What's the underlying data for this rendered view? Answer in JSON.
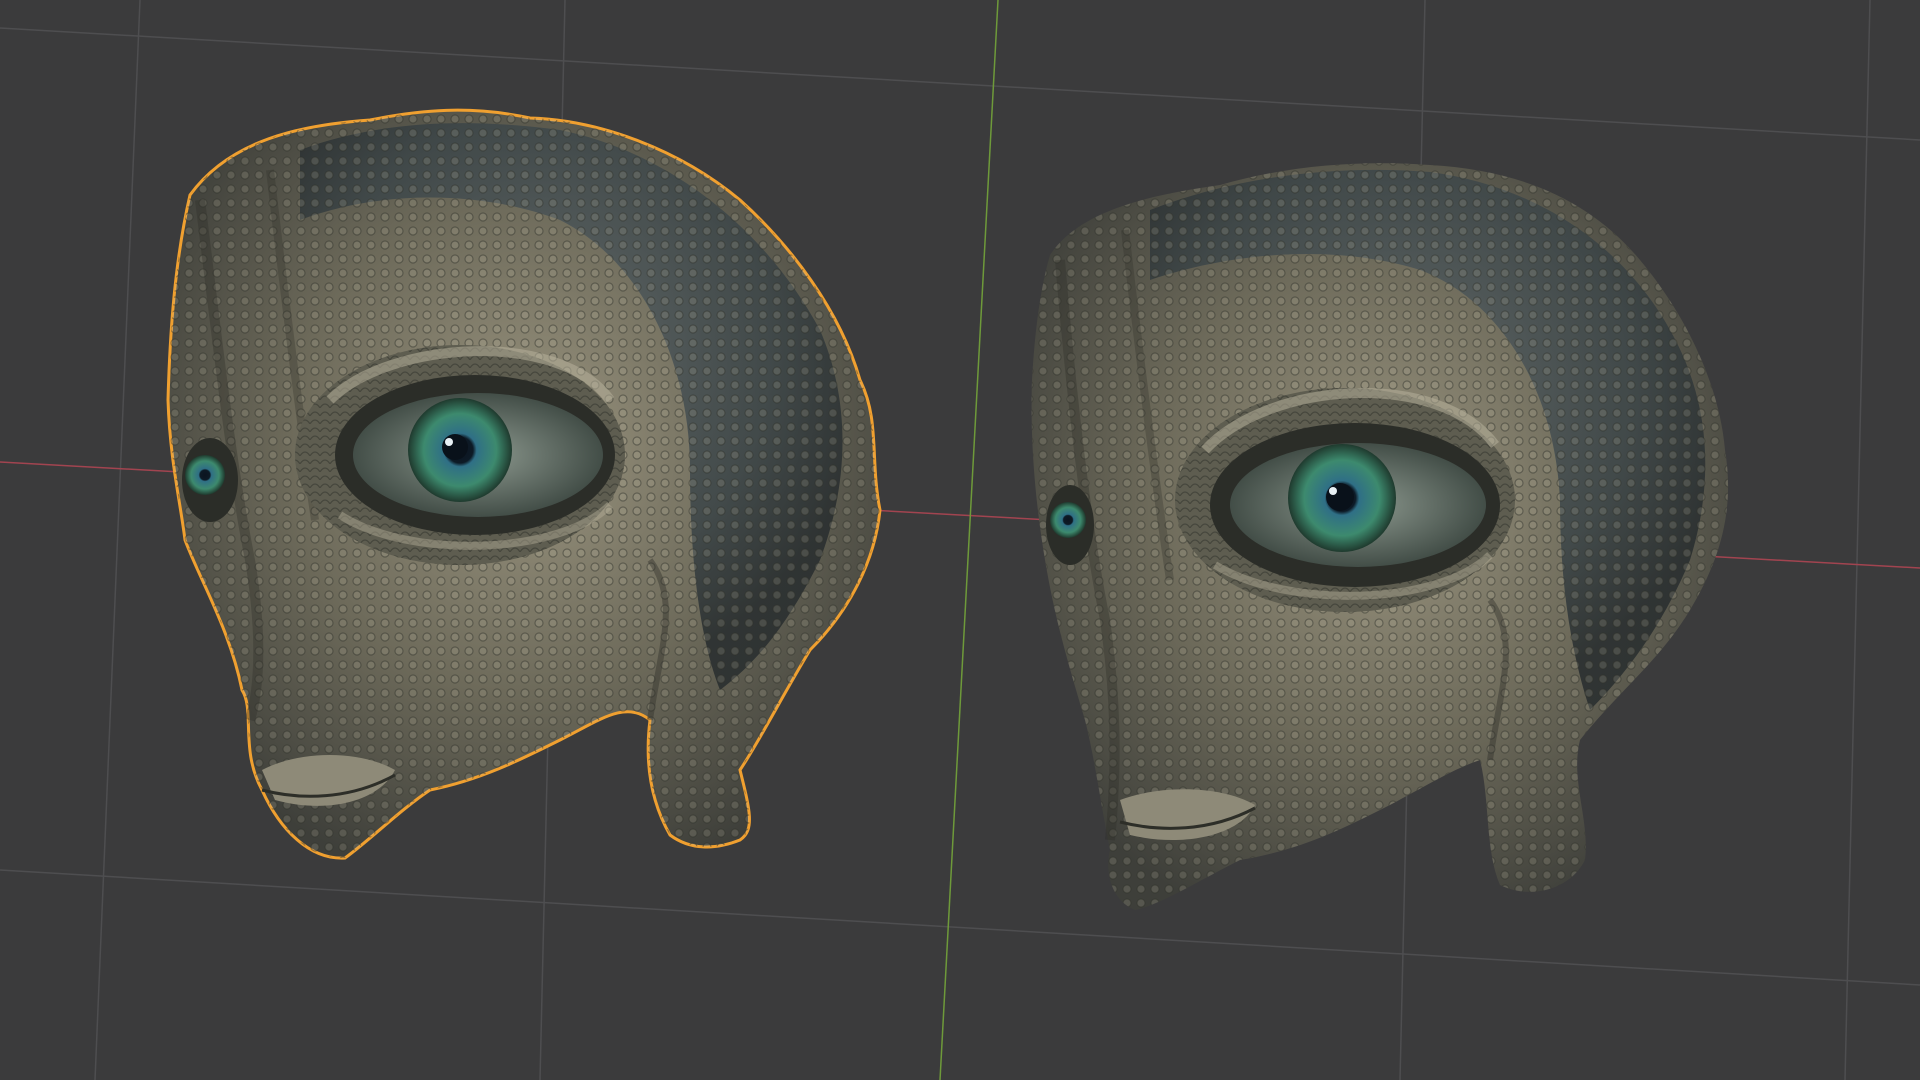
{
  "viewport": {
    "background_color": "#3b3b3c",
    "grid_color": "#4e4e50",
    "x_axis_color": "#a24450",
    "y_axis_color": "#6e9a3a",
    "selection_outline_color": "#f0a030"
  },
  "objects": [
    {
      "kind": "alien-head-mesh",
      "selected": true
    },
    {
      "kind": "alien-head-mesh",
      "selected": false
    }
  ]
}
